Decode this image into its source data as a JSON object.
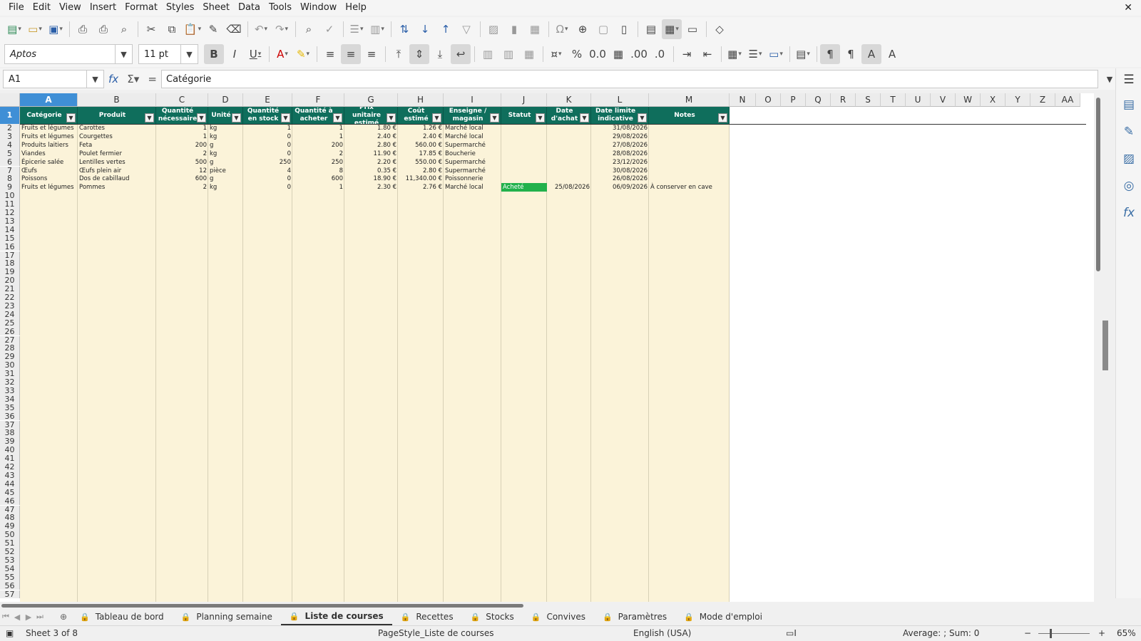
{
  "menu": [
    "File",
    "Edit",
    "View",
    "Insert",
    "Format",
    "Styles",
    "Sheet",
    "Data",
    "Tools",
    "Window",
    "Help"
  ],
  "close_glyph": "✕",
  "toolbar": {
    "font_name": "Aptos",
    "font_size": "11 pt"
  },
  "formula": {
    "cell_ref": "A1",
    "content": "Catégorie"
  },
  "columns": [
    "A",
    "B",
    "C",
    "D",
    "E",
    "F",
    "G",
    "H",
    "I",
    "J",
    "K",
    "L",
    "M",
    "N",
    "O",
    "P",
    "Q",
    "R",
    "S",
    "T",
    "U",
    "V",
    "W",
    "X",
    "Y",
    "Z",
    "AA"
  ],
  "header_row": [
    "Catégorie",
    "Produit",
    "Quantité nécessaire",
    "Unité",
    "Quantité en stock",
    "Quantité à acheter",
    "Prix unitaire estimé",
    "Coût estimé",
    "Enseigne / magasin",
    "Statut",
    "Date d'achat",
    "Date limite indicative",
    "Notes"
  ],
  "rows": [
    [
      "Fruits et légumes",
      "Carottes",
      "1",
      "kg",
      "1",
      "1",
      "1.80 €",
      "1.26 €",
      "Marché local",
      "",
      "",
      "31/08/2026",
      ""
    ],
    [
      "Fruits et légumes",
      "Courgettes",
      "1",
      "kg",
      "0",
      "1",
      "2.40 €",
      "2.40 €",
      "Marché local",
      "",
      "",
      "29/08/2026",
      ""
    ],
    [
      "Produits laitiers",
      "Feta",
      "200",
      "g",
      "0",
      "200",
      "2.80 €",
      "560.00 €",
      "Supermarché",
      "",
      "",
      "27/08/2026",
      ""
    ],
    [
      "Viandes",
      "Poulet fermier",
      "2",
      "kg",
      "0",
      "2",
      "11.90 €",
      "17.85 €",
      "Boucherie",
      "",
      "",
      "28/08/2026",
      ""
    ],
    [
      "Épicerie salée",
      "Lentilles vertes",
      "500",
      "g",
      "250",
      "250",
      "2.20 €",
      "550.00 €",
      "Supermarché",
      "",
      "",
      "23/12/2026",
      ""
    ],
    [
      "Œufs",
      "Œufs plein air",
      "12",
      "pièce",
      "4",
      "8",
      "0.35 €",
      "2.80 €",
      "Supermarché",
      "",
      "",
      "30/08/2026",
      ""
    ],
    [
      "Poissons",
      "Dos de cabillaud",
      "600",
      "g",
      "0",
      "600",
      "18.90 €",
      "11,340.00 €",
      "Poissonnerie",
      "",
      "",
      "26/08/2026",
      ""
    ],
    [
      "Fruits et légumes",
      "Pommes",
      "2",
      "kg",
      "0",
      "1",
      "2.30 €",
      "2.76 €",
      "Marché local",
      "Acheté",
      "25/08/2026",
      "06/09/2026",
      "À conserver en cave"
    ]
  ],
  "visible_row_numbers": 57,
  "sheets": [
    "Tableau de bord",
    "Planning semaine",
    "Liste de courses",
    "Recettes",
    "Stocks",
    "Convives",
    "Paramètres",
    "Mode d'emploi"
  ],
  "active_sheet": "Liste de courses",
  "status": {
    "sheet_pos": "Sheet 3 of 8",
    "page_style": "PageStyle_Liste de courses",
    "language": "English (USA)",
    "summary": "Average: ; Sum: 0",
    "zoom": "65%"
  },
  "colors": {
    "header_bg": "#0f6e5c",
    "table_tint": "#fbf3d9",
    "status_bought": "#22b14c",
    "selection": "#3f8fd6"
  }
}
